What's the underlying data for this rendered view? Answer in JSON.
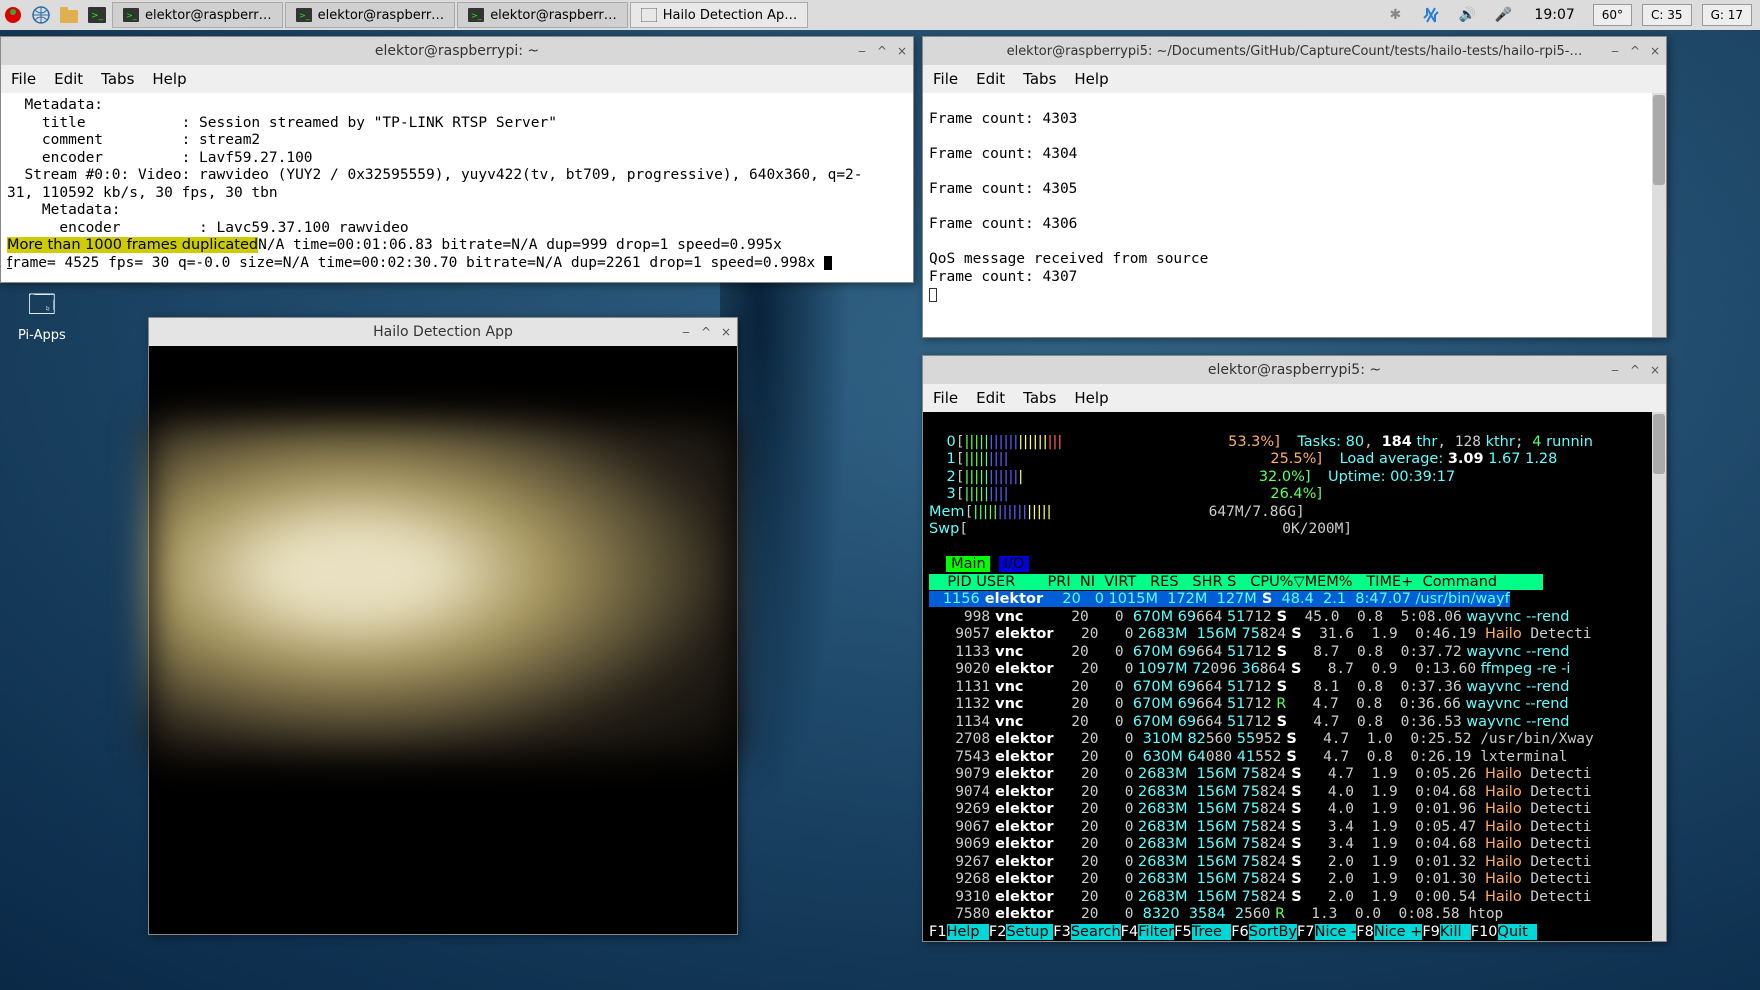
{
  "taskbar": {
    "apps": [
      {
        "icon": "terminal",
        "label": "elektor@raspberr…"
      },
      {
        "icon": "terminal",
        "label": "elektor@raspberr…"
      },
      {
        "icon": "terminal",
        "label": "elektor@raspberr…"
      },
      {
        "icon": "window",
        "label": "Hailo Detection Ap…"
      }
    ],
    "clock": "19:07",
    "temp": "60°",
    "c_stat": "C: 35",
    "g_stat": "G: 17"
  },
  "desktop_icon": "Pi-Apps",
  "menus": {
    "file": "File",
    "edit": "Edit",
    "tabs": "Tabs",
    "help": "Help"
  },
  "term1": {
    "title": "elektor@raspberrypi: ~",
    "lines": [
      "  Metadata:",
      "    title           : Session streamed by \"TP-LINK RTSP Server\"",
      "    comment         : stream2",
      "    encoder         : Lavf59.27.100",
      "  Stream #0:0: Video: rawvideo (YUY2 / 0x32595559), yuyv422(tv, bt709, progressive), 640x360, q=2-",
      "31, 110592 kb/s, 30 fps, 30 tbn",
      "    Metadata:",
      "      encoder         : Lavc59.37.100 rawvideo"
    ],
    "hl": "More than 1000 frames duplicated",
    "after_hl": "N/A time=00:01:06.83 bitrate=N/A dup=999 drop=1 speed=0.995x",
    "last": "frame= 4525 fps= 30 q=-0.0 size=N/A time=00:02:30.70 bitrate=N/A dup=2261 drop=1 speed=0.998x "
  },
  "term2": {
    "title": "elektor@raspberrypi5: ~/Documents/GitHub/CaptureCount/tests/hailo-tests/hailo-rpi5-…",
    "lines": [
      "Frame count: 4303",
      "",
      "Frame count: 4304",
      "",
      "Frame count: 4305",
      "",
      "Frame count: 4306",
      "",
      "QoS message received from source",
      "Frame count: 4307"
    ]
  },
  "detect": {
    "title": "Hailo Detection App"
  },
  "htop": {
    "title": "elektor@raspberrypi5: ~",
    "cpu": [
      {
        "n": "0",
        "bar": "[||||||||||||||||||||                   ",
        "pct": "53.3%]"
      },
      {
        "n": "1",
        "bar": "[|||||||||                              ",
        "pct": "25.5%]"
      },
      {
        "n": "2",
        "bar": "[||||||||||||                           ",
        "pct": "32.0%]"
      },
      {
        "n": "3",
        "bar": "[|||||||||                              ",
        "pct": "26.4%]"
      }
    ],
    "mem": {
      "label": "Mem",
      "bar": "[||||||||||||||||                  647M/7.86G]"
    },
    "swp": {
      "label": "Swp",
      "bar": "[                                    0K/200M]"
    },
    "tasks_label": "Tasks: ",
    "tasks_v1": "80",
    "tasks_sep": ", ",
    "tasks_v2": "184",
    "tasks_thr": " thr",
    "tasks_sep2": ", ",
    "tasks_kthr": "128",
    "tasks_kthr_l": " kthr",
    "tasks_sep3": "; ",
    "tasks_run": "4",
    "tasks_run_l": " runnin",
    "load_label": "Load average: ",
    "load1": "3.09",
    "load2": " 1.67 1.28",
    "uptime_label": "Uptime: ",
    "uptime": "00:39:17",
    "tab_main": "Main",
    "tab_io": " I/O ",
    "header": "    PID USER       PRI  NI  VIRT   RES   SHR S   CPU%▽MEM%   TIME+  Command          ",
    "rows": [
      {
        "sel": true,
        "pid": "   1156",
        "user": " elektor  ",
        "pri": "  20",
        "ni": "   0",
        "virt": " 1015M",
        "res": "  172M",
        "shrA": "  127",
        "shrB": "M",
        "s": " S",
        "cpu": "  48.4",
        "mem": "  2.1",
        "time": "  8:47.07",
        "cmd1": " /usr/bin/wayf",
        "cmd2": "",
        "cmd3": ""
      },
      {
        "pid": "    998",
        "user": " vnc      ",
        "pri": "  20",
        "ni": "   0",
        "virt": "  670M",
        "res": " 69",
        "resB": "664",
        "shrA": " 51",
        "shrB": "712",
        "s": " S",
        "cpu": "  45.0",
        "mem": "  0.8",
        "time": "  5:08.06",
        "cmd1": " wayvnc --rend",
        "cmdcy": true
      },
      {
        "pid": "   9057",
        "user": " elektor  ",
        "pri": "  20",
        "ni": "   0",
        "virt": " 2683M",
        "res": "  156M",
        "shrA": " 75",
        "shrB": "824",
        "s": " S",
        "cpu": "  31.6",
        "mem": "  1.9",
        "time": "  0:46.19",
        "cmd1": " ",
        "cmdor": "Hailo",
        "cmd2": " Detecti"
      },
      {
        "pid": "   1133",
        "user": " vnc      ",
        "pri": "  20",
        "ni": "   0",
        "virt": "  670M",
        "res": " 69",
        "resB": "664",
        "shrA": " 51",
        "shrB": "712",
        "s": " S",
        "cpu": "   8.7",
        "mem": "  0.8",
        "time": "  0:37.72",
        "cmd1": " wayvnc --rend",
        "cmdcy": true
      },
      {
        "pid": "   9020",
        "user": " elektor  ",
        "pri": "  20",
        "ni": "   0",
        "virt": " 1097M",
        "res": " 72",
        "resB": "096",
        "shrA": " 36",
        "shrB": "864",
        "s": " S",
        "cpu": "   8.7",
        "mem": "  0.9",
        "time": "  0:13.60",
        "cmd1": " ffmpeg -re -i",
        "cmdcy": true
      },
      {
        "pid": "   1131",
        "user": " vnc      ",
        "pri": "  20",
        "ni": "   0",
        "virt": "  670M",
        "res": " 69",
        "resB": "664",
        "shrA": " 51",
        "shrB": "712",
        "s": " S",
        "cpu": "   8.1",
        "mem": "  0.8",
        "time": "  0:37.36",
        "cmd1": " wayvnc --rend",
        "cmdcy": true
      },
      {
        "pid": "   1132",
        "user": " vnc      ",
        "pri": "  20",
        "ni": "   0",
        "virt": "  670M",
        "res": " 69",
        "resB": "664",
        "shrA": " 51",
        "shrB": "712",
        "sg": " R",
        "cpu": "   4.7",
        "mem": "  0.8",
        "time": "  0:36.66",
        "cmd1": " wayvnc --rend",
        "cmdcy": true
      },
      {
        "pid": "   1134",
        "user": " vnc      ",
        "pri": "  20",
        "ni": "   0",
        "virt": "  670M",
        "res": " 69",
        "resB": "664",
        "shrA": " 51",
        "shrB": "712",
        "s": " S",
        "cpu": "   4.7",
        "mem": "  0.8",
        "time": "  0:36.53",
        "cmd1": " wayvnc --rend",
        "cmdcy": true
      },
      {
        "pid": "   2708",
        "user": " elektor  ",
        "pri": "  20",
        "ni": "   0",
        "virt": "  310M",
        "res": " 82",
        "resB": "560",
        "shrA": " 55",
        "shrB": "952",
        "s": " S",
        "cpu": "   4.7",
        "mem": "  1.0",
        "time": "  0:25.52",
        "cmd1": " /usr/bin/Xway"
      },
      {
        "pid": "   7543",
        "user": " elektor  ",
        "pri": "  20",
        "ni": "   0",
        "virt": "  630M",
        "res": " 64",
        "resB": "080",
        "shrA": " 41",
        "shrB": "552",
        "s": " S",
        "cpu": "   4.7",
        "mem": "  0.8",
        "time": "  0:26.19",
        "cmd1": " lxterminal"
      },
      {
        "pid": "   9079",
        "user": " elektor  ",
        "pri": "  20",
        "ni": "   0",
        "virt": " 2683M",
        "res": "  156M",
        "shrA": " 75",
        "shrB": "824",
        "s": " S",
        "cpu": "   4.7",
        "mem": "  1.9",
        "time": "  0:05.26",
        "cmd1": " ",
        "cmdor": "Hailo",
        "cmd2": " Detecti"
      },
      {
        "pid": "   9074",
        "user": " elektor  ",
        "pri": "  20",
        "ni": "   0",
        "virt": " 2683M",
        "res": "  156M",
        "shrA": " 75",
        "shrB": "824",
        "s": " S",
        "cpu": "   4.0",
        "mem": "  1.9",
        "time": "  0:04.68",
        "cmd1": " ",
        "cmdor": "Hailo",
        "cmd2": " Detecti"
      },
      {
        "pid": "   9269",
        "user": " elektor  ",
        "pri": "  20",
        "ni": "   0",
        "virt": " 2683M",
        "res": "  156M",
        "shrA": " 75",
        "shrB": "824",
        "s": " S",
        "cpu": "   4.0",
        "mem": "  1.9",
        "time": "  0:01.96",
        "cmd1": " ",
        "cmdor": "Hailo",
        "cmd2": " Detecti"
      },
      {
        "pid": "   9067",
        "user": " elektor  ",
        "pri": "  20",
        "ni": "   0",
        "virt": " 2683M",
        "res": "  156M",
        "shrA": " 75",
        "shrB": "824",
        "s": " S",
        "cpu": "   3.4",
        "mem": "  1.9",
        "time": "  0:05.47",
        "cmd1": " ",
        "cmdor": "Hailo",
        "cmd2": " Detecti"
      },
      {
        "pid": "   9069",
        "user": " elektor  ",
        "pri": "  20",
        "ni": "   0",
        "virt": " 2683M",
        "res": "  156M",
        "shrA": " 75",
        "shrB": "824",
        "s": " S",
        "cpu": "   3.4",
        "mem": "  1.9",
        "time": "  0:04.68",
        "cmd1": " ",
        "cmdor": "Hailo",
        "cmd2": " Detecti"
      },
      {
        "pid": "   9267",
        "user": " elektor  ",
        "pri": "  20",
        "ni": "   0",
        "virt": " 2683M",
        "res": "  156M",
        "shrA": " 75",
        "shrB": "824",
        "s": " S",
        "cpu": "   2.0",
        "mem": "  1.9",
        "time": "  0:01.32",
        "cmd1": " ",
        "cmdor": "Hailo",
        "cmd2": " Detecti"
      },
      {
        "pid": "   9268",
        "user": " elektor  ",
        "pri": "  20",
        "ni": "   0",
        "virt": " 2683M",
        "res": "  156M",
        "shrA": " 75",
        "shrB": "824",
        "s": " S",
        "cpu": "   2.0",
        "mem": "  1.9",
        "time": "  0:01.30",
        "cmd1": " ",
        "cmdor": "Hailo",
        "cmd2": " Detecti"
      },
      {
        "pid": "   9310",
        "user": " elektor  ",
        "pri": "  20",
        "ni": "   0",
        "virt": " 2683M",
        "res": "  156M",
        "shrA": " 75",
        "shrB": "824",
        "s": " S",
        "cpu": "   2.0",
        "mem": "  1.9",
        "time": "  0:00.54",
        "cmd1": " ",
        "cmdor": "Hailo",
        "cmd2": " Detecti"
      },
      {
        "pid": "   7580",
        "user": " elektor  ",
        "pri": "  20",
        "ni": "   0",
        "virt": "  8320",
        "res": "  3584",
        "shrA": "  2",
        "shrB": "560",
        "sg": " R",
        "cpu": "   1.3",
        "mem": "  0.0",
        "time": "  0:08.58",
        "cmd1": " htop"
      }
    ],
    "fnbar": [
      {
        "k": "F1",
        "l": "Help  "
      },
      {
        "k": "F2",
        "l": "Setup "
      },
      {
        "k": "F3",
        "l": "Search"
      },
      {
        "k": "F4",
        "l": "Filter"
      },
      {
        "k": "F5",
        "l": "Tree  "
      },
      {
        "k": "F6",
        "l": "SortBy"
      },
      {
        "k": "F7",
        "l": "Nice -"
      },
      {
        "k": "F8",
        "l": "Nice +"
      },
      {
        "k": "F9",
        "l": "Kill  "
      },
      {
        "k": "F10",
        "l": "Quit  "
      }
    ]
  }
}
